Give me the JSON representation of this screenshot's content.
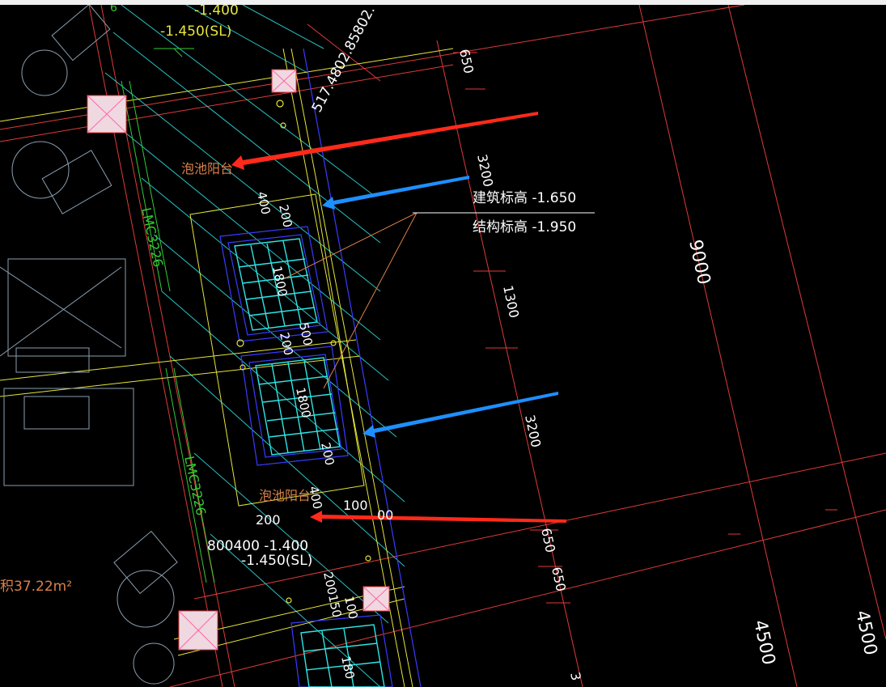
{
  "colors": {
    "background": "#000000",
    "axis_red": "#e03a3a",
    "cyan": "#2ee6e6",
    "blue": "#3a3aff",
    "yellow": "#e6e63a",
    "green": "#33cc33",
    "orange_text": "#d9824a",
    "white": "#ffffff",
    "arrow_red": "#ff2a1a",
    "arrow_blue": "#1e8fff",
    "grey_lines": "#8a9fb0"
  },
  "labels": {
    "elev_top_1": "-1.400",
    "elev_top_2": "-1.450(SL)",
    "coord": "517.4802.85802.",
    "balcony_label_upper": "泡池阳台",
    "balcony_label_lower": "泡池阳台",
    "building_elev": "建筑标高 -1.650",
    "structure_elev": "结构标高 -1.950",
    "door_tag_1": "LMC3226",
    "door_tag_2": "LMC3226",
    "elev_bottom_1": "800400 -1.400",
    "elev_bottom_2": "-1.450(SL)",
    "area": "积37.22m²",
    "dim_650_top": "650",
    "dim_3200_a": "3200",
    "dim_1300": "1300",
    "dim_3200_b": "3200",
    "dim_650_b1": "650",
    "dim_650_b2": "650",
    "dim_9000": "9000",
    "dim_4500_a": "4500",
    "dim_4500_b": "4500",
    "dim_3_bottom": "3",
    "dim_400_a": "400",
    "dim_200_a": "200",
    "dim_1800_a": "1800",
    "dim_500": "500",
    "dim_200_b": "200",
    "dim_1800_b": "1800",
    "dim_200_c": "200",
    "dim_400_b": "400",
    "dim_200_d": "200",
    "dim_100": "100",
    "dim_00": "00",
    "dim_200150": "200150",
    "dim_100_b": "100",
    "dim_180": "180",
    "dim_6": "6"
  }
}
